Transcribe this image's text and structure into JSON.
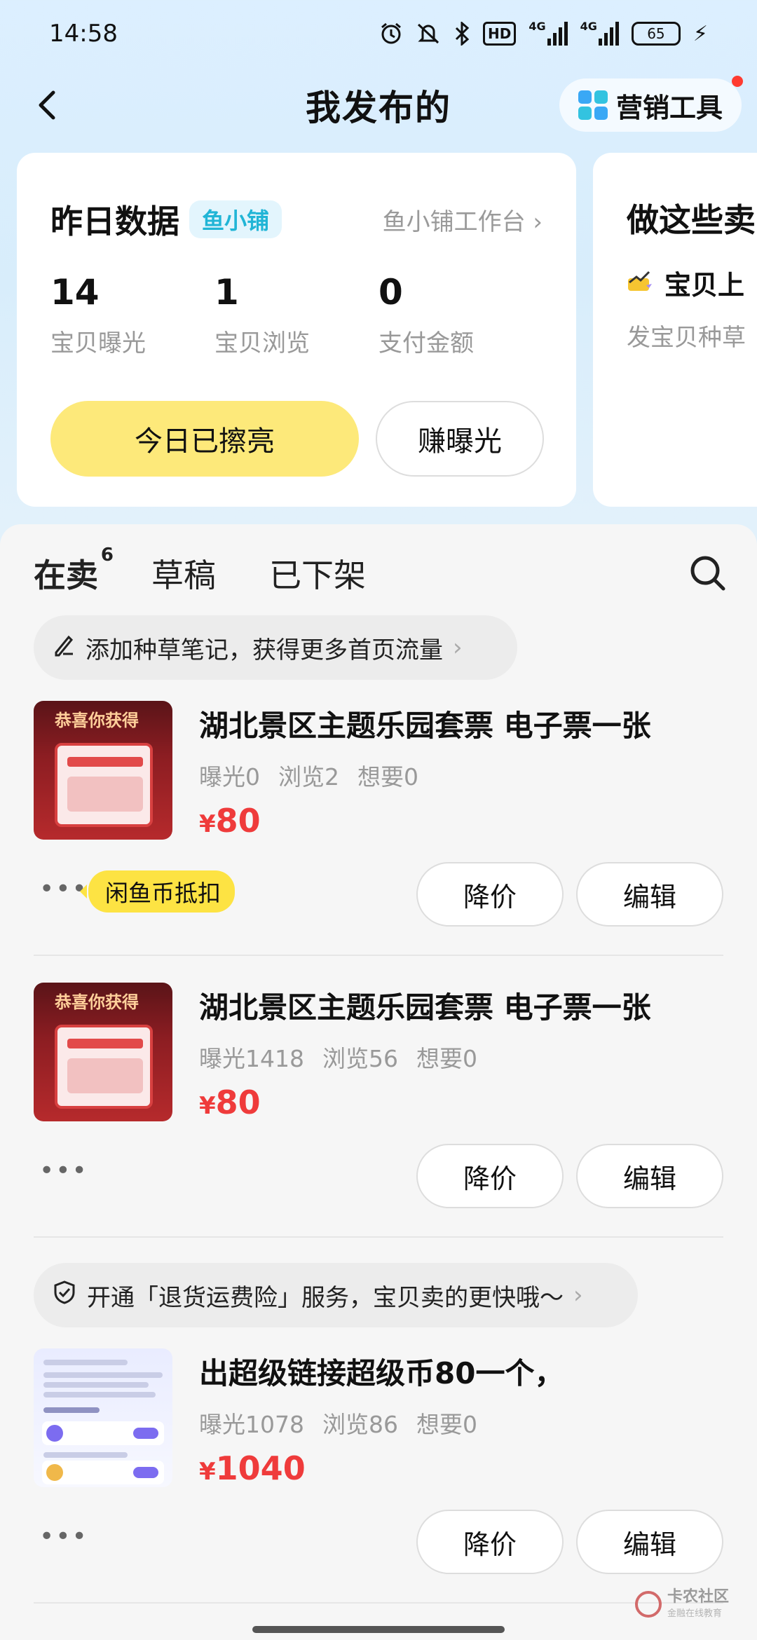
{
  "status_bar": {
    "time": "14:58",
    "net_1": "4G",
    "net_2": "4G",
    "hd": "HD",
    "battery": "65"
  },
  "header": {
    "title": "我发布的",
    "marketing_label": "营销工具"
  },
  "data_card": {
    "title": "昨日数据",
    "badge": "鱼小铺",
    "workbench_link": "鱼小铺工作台",
    "stats": [
      {
        "value": "14",
        "label": "宝贝曝光"
      },
      {
        "value": "1",
        "label": "宝贝浏览"
      },
      {
        "value": "0",
        "label": "支付金额"
      }
    ],
    "primary_button": "今日已擦亮",
    "secondary_button": "赚曝光"
  },
  "peek_card": {
    "title": "做这些卖",
    "item": "宝贝上",
    "sub": "发宝贝种草"
  },
  "tabs": {
    "items": [
      {
        "label": "在卖",
        "count": "6"
      },
      {
        "label": "草稿"
      },
      {
        "label": "已下架"
      }
    ]
  },
  "tips": {
    "notes_tip": "添加种草笔记，获得更多首页流量",
    "insurance_tip": "开通「退货运费险」服务，宝贝卖的更快哦～"
  },
  "items": [
    {
      "title": "湖北景区主题乐园套票 电子票一张",
      "exposure": "曝光0",
      "views": "浏览2",
      "wants": "想要0",
      "currency": "¥",
      "price": "80",
      "coin_badge": "闲鱼币抵扣",
      "thumb_text": "恭喜你获得"
    },
    {
      "title": "湖北景区主题乐园套票 电子票一张",
      "exposure": "曝光1418",
      "views": "浏览56",
      "wants": "想要0",
      "currency": "¥",
      "price": "80",
      "thumb_text": "恭喜你获得"
    },
    {
      "title": "出超级链接超级币80一个，",
      "exposure": "曝光1078",
      "views": "浏览86",
      "wants": "想要0",
      "currency": "¥",
      "price": "1040"
    }
  ],
  "actions": {
    "more": "•••",
    "reduce_price": "降价",
    "edit": "编辑"
  },
  "watermark": {
    "name": "卡农社区",
    "sub": "金融在线教育"
  },
  "colors": {
    "accent_yellow": "#fde343",
    "price_red": "#ef3b3b",
    "badge_cyan": "#21b5d6"
  }
}
